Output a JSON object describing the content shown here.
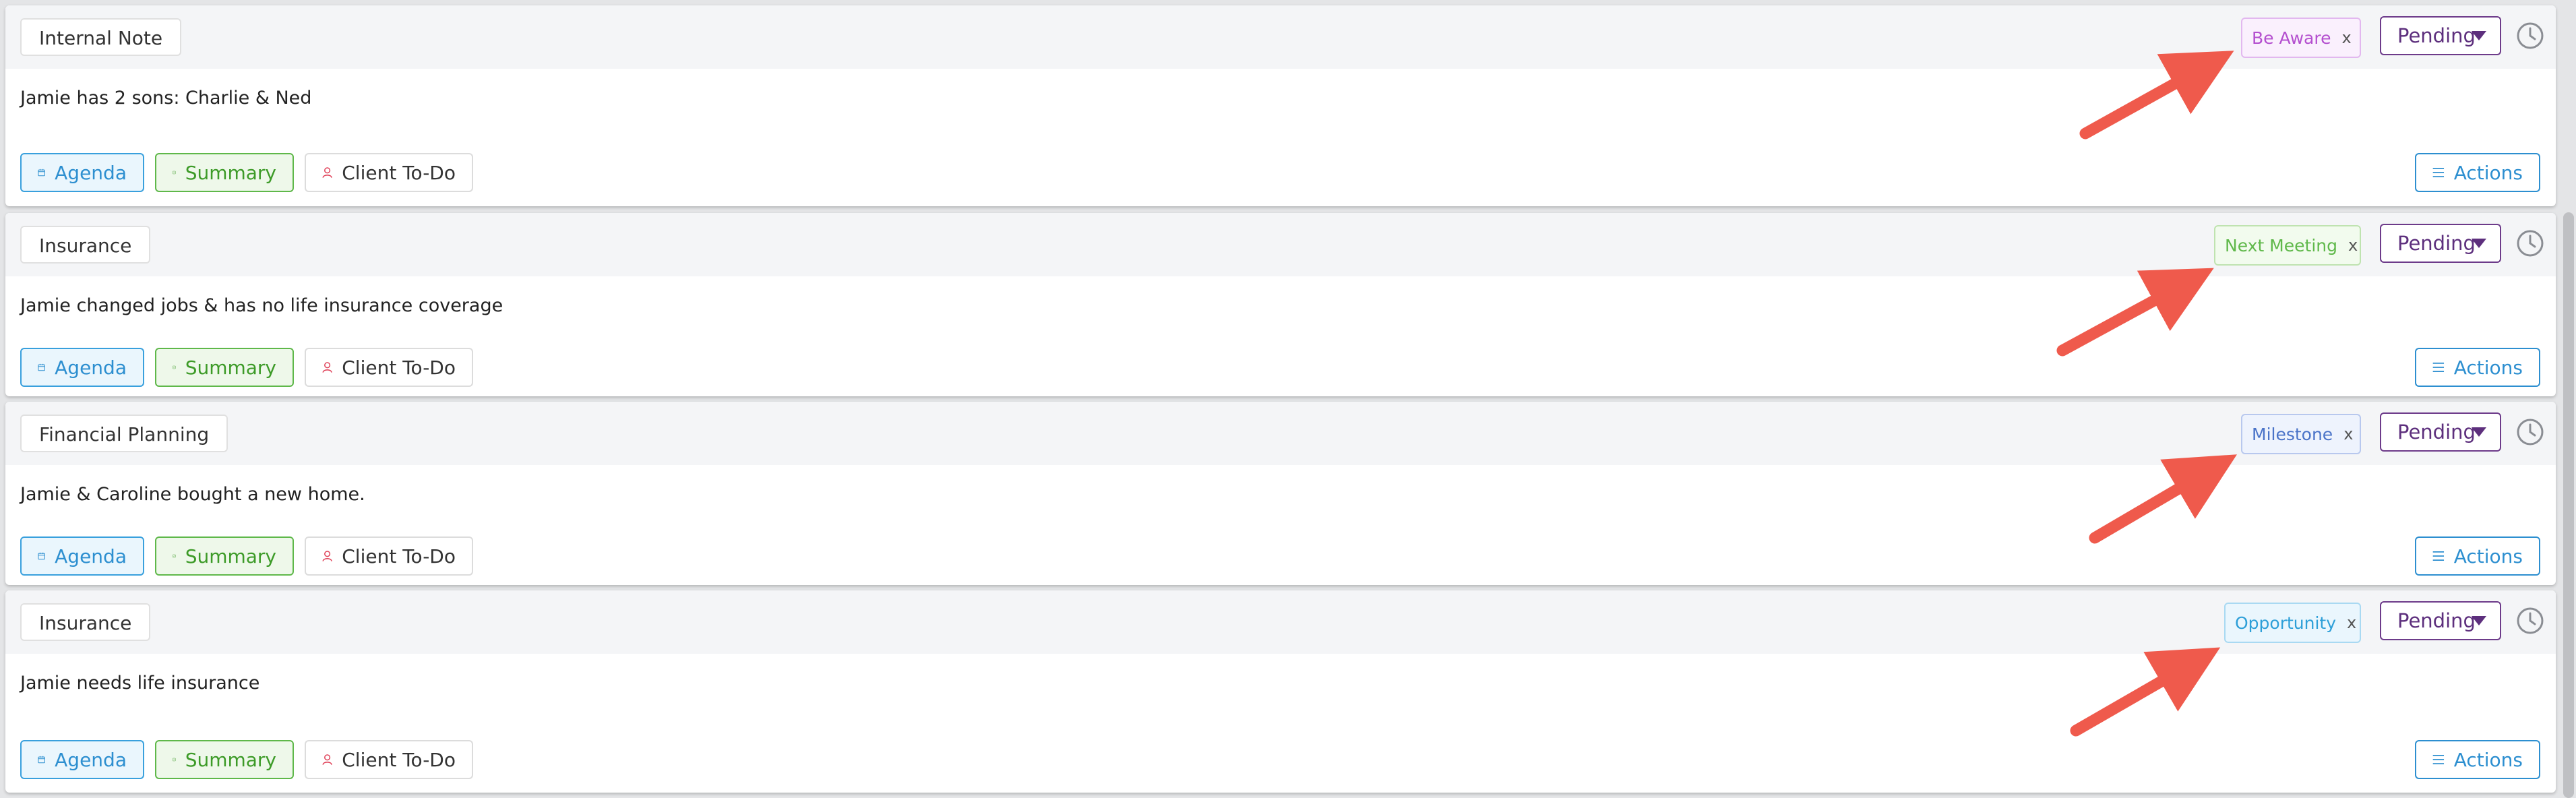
{
  "notes": [
    {
      "category": "Internal Note",
      "text": "Jamie has 2 sons: Charlie & Ned",
      "tag": {
        "label": "Be Aware",
        "close": "x"
      },
      "status": "Pending"
    },
    {
      "category": "Insurance",
      "text": "Jamie changed jobs & has no life insurance coverage",
      "tag": {
        "label": "Next Meeting",
        "close": "x"
      },
      "status": "Pending"
    },
    {
      "category": "Financial Planning",
      "text": "Jamie & Caroline bought a new home.",
      "tag": {
        "label": "Milestone",
        "close": "x"
      },
      "status": "Pending"
    },
    {
      "category": "Insurance",
      "text": "Jamie needs life insurance",
      "tag": {
        "label": "Opportunity",
        "close": "x"
      },
      "status": "Pending"
    }
  ],
  "buttons": {
    "agenda": "Agenda",
    "summary": "Summary",
    "client_todo": "Client To-Do",
    "actions": "Actions"
  },
  "colors": {
    "be_aware": "#b44fcf",
    "next_meeting": "#5fb84a",
    "milestone": "#4a73c8",
    "opportunity": "#2d9fd8",
    "status": "#5d2f7d",
    "annotation_arrow": "#ef5a4c"
  },
  "icons": {
    "agenda": "calendar-icon",
    "summary": "check-square-icon",
    "client_todo": "user-icon",
    "actions": "menu-icon",
    "status": "caret-down-icon",
    "history": "clock-icon"
  }
}
